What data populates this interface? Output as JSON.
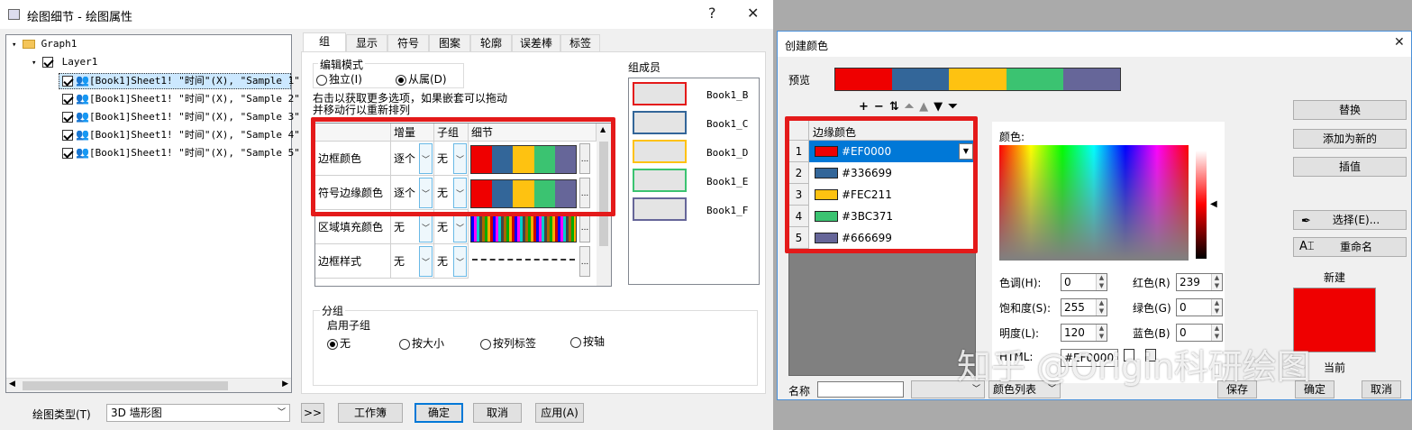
{
  "left_window": {
    "title": "绘图细节 - 绘图属性",
    "help_btn": "?",
    "close_btn": "✕",
    "tree": {
      "root": "Graph1",
      "layer": "Layer1",
      "items": [
        "[Book1]Sheet1! \"时间\"(X), \"Sample 1\"",
        "[Book1]Sheet1! \"时间\"(X), \"Sample 2\"",
        "[Book1]Sheet1! \"时间\"(X), \"Sample 3\"",
        "[Book1]Sheet1! \"时间\"(X), \"Sample 4\"",
        "[Book1]Sheet1! \"时间\"(X), \"Sample 5\""
      ]
    },
    "tabs": [
      "组",
      "显示",
      "符号",
      "图案",
      "轮廓",
      "误差棒",
      "标签"
    ],
    "edit_mode": {
      "legend": "编辑模式",
      "independent": "独立(I)",
      "dependent": "从属(D)"
    },
    "hint": "右击以获取更多选项，如果嵌套可以拖动并移动行以重新排列",
    "grid": {
      "headers": [
        "增量",
        "子组",
        "细节"
      ],
      "rows": [
        {
          "name": "边框颜色",
          "inc": "逐个",
          "sub": "无"
        },
        {
          "name": "符号边缘颜色",
          "inc": "逐个",
          "sub": "无"
        },
        {
          "name": "区域填充颜色",
          "inc": "无",
          "sub": "无"
        },
        {
          "name": "边框样式",
          "inc": "无",
          "sub": "无"
        }
      ],
      "ellipsis": "..."
    },
    "members": {
      "title": "组成员",
      "items": [
        {
          "label": "Book1_B",
          "color": "#e41a1a"
        },
        {
          "label": "Book1_C",
          "color": "#336699"
        },
        {
          "label": "Book1_D",
          "color": "#fec211"
        },
        {
          "label": "Book1_E",
          "color": "#3bc371"
        },
        {
          "label": "Book1_F",
          "color": "#666699"
        }
      ]
    },
    "grouping": {
      "title": "分组",
      "sub": "启用子组",
      "options": [
        "无",
        "按大小",
        "按列标签",
        "按轴"
      ]
    },
    "plot_type_label": "绘图类型(T)",
    "plot_type_value": "3D 墙形图",
    "buttons": {
      "more": ">>",
      "workbook": "工作簿",
      "ok": "确定",
      "cancel": "取消",
      "apply": "应用(A)"
    }
  },
  "right_window": {
    "title": "创建颜色",
    "close_btn": "✕",
    "preview_label": "预览",
    "palette": [
      "#EF0000",
      "#336699",
      "#FEC211",
      "#3BC371",
      "#666699"
    ],
    "toolbar": [
      "+",
      "−",
      "⇅",
      "⏶",
      "▲",
      "▼",
      "⏷"
    ],
    "list_header": "边缘颜色",
    "colors": [
      {
        "n": "1",
        "hex": "#EF0000"
      },
      {
        "n": "2",
        "hex": "#336699"
      },
      {
        "n": "3",
        "hex": "#FEC211"
      },
      {
        "n": "4",
        "hex": "#3BC371"
      },
      {
        "n": "5",
        "hex": "#666699"
      }
    ],
    "picker_label": "颜色:",
    "fields": {
      "hue_label": "色调(H):",
      "hue": "0",
      "sat_label": "饱和度(S):",
      "sat": "255",
      "lum_label": "明度(L):",
      "lum": "120",
      "red_label": "红色(R)",
      "red": "239",
      "green_label": "绿色(G)",
      "green": "0",
      "blue_label": "蓝色(B)",
      "blue": "0",
      "html_label": "HTML:",
      "html": "#EF0000"
    },
    "side_buttons": {
      "replace": "替换",
      "add_new": "添加为新的",
      "interpolate": "插值",
      "pick": "选择(E)...",
      "rename": "重命名"
    },
    "new_label": "新建",
    "current_label": "当前",
    "name_label": "名称",
    "color_list": "颜色列表",
    "bottom_buttons": {
      "save": "保存",
      "ok": "确定",
      "cancel": "取消"
    }
  },
  "watermark": "知乎 @Origin科研绘图"
}
